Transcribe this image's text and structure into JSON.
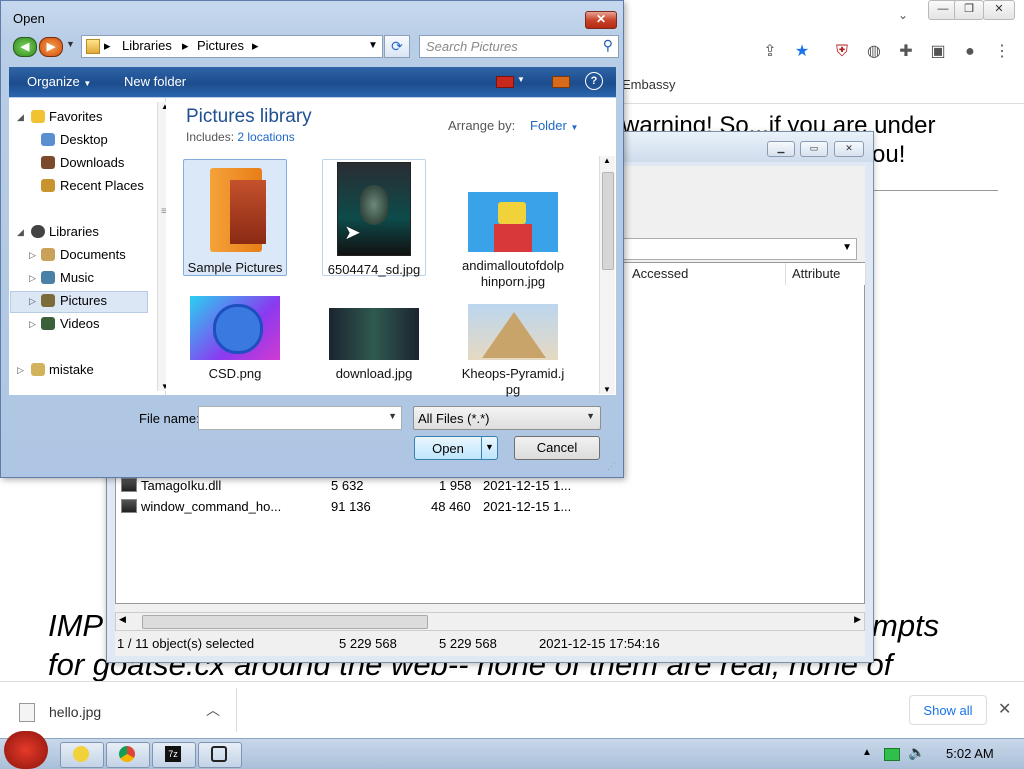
{
  "browser": {
    "bookmark": "Embassy",
    "page_lines": [
      "warning! So...if you are under",
      "ou!"
    ],
    "page_italic": [
      "IMP",
      "mpts",
      "for goatse.cx around the web-- none of them are real, none of"
    ]
  },
  "zip_window": {
    "columns": [
      "Accessed",
      "Attribute"
    ],
    "rows": [
      {
        "name": "TamagoIku.dll",
        "size": "5 632",
        "packed": "1 958",
        "date": "2021-12-15 1..."
      },
      {
        "name": "window_command_ho...",
        "size": "91 136",
        "packed": "48 460",
        "date": "2021-12-15 1..."
      }
    ],
    "status": {
      "selection": "1 / 11 object(s) selected",
      "size": "5 229 568",
      "packed": "5 229 568",
      "date": "2021-12-15 17:54:16"
    }
  },
  "dialog": {
    "title": "Open",
    "breadcrumb": [
      "Libraries",
      "Pictures"
    ],
    "search_placeholder": "Search Pictures",
    "toolbar": {
      "organize": "Organize",
      "new_folder": "New folder"
    },
    "nav": {
      "favorites": "Favorites",
      "desktop": "Desktop",
      "downloads": "Downloads",
      "recent": "Recent Places",
      "libraries": "Libraries",
      "documents": "Documents",
      "music": "Music",
      "pictures": "Pictures",
      "videos": "Videos",
      "mistake": "mistake"
    },
    "library": {
      "title": "Pictures library",
      "includes_label": "Includes:",
      "includes_link": "2 locations",
      "arrange_label": "Arrange by:",
      "arrange_value": "Folder"
    },
    "items": [
      {
        "label": "Sample Pictures"
      },
      {
        "label": "6504474_sd.jpg"
      },
      {
        "label": "andimalloutofdolphinporn.jpg"
      },
      {
        "label": "CSD.png"
      },
      {
        "label": "download.jpg"
      },
      {
        "label": "Kheops-Pyramid.jpg"
      }
    ],
    "file_name_label": "File name:",
    "file_name_value": "",
    "file_type": "All Files (*.*)",
    "open_label": "Open",
    "cancel_label": "Cancel"
  },
  "download_bar": {
    "file": "hello.jpg",
    "show_all": "Show all"
  },
  "taskbar": {
    "time": "5:02 AM"
  },
  "colors": {
    "title_blue": "#1e4f91",
    "link_blue": "#2068c8",
    "cmdbar": "#1c4d8e",
    "chrome_blue": "#1a73e8"
  }
}
